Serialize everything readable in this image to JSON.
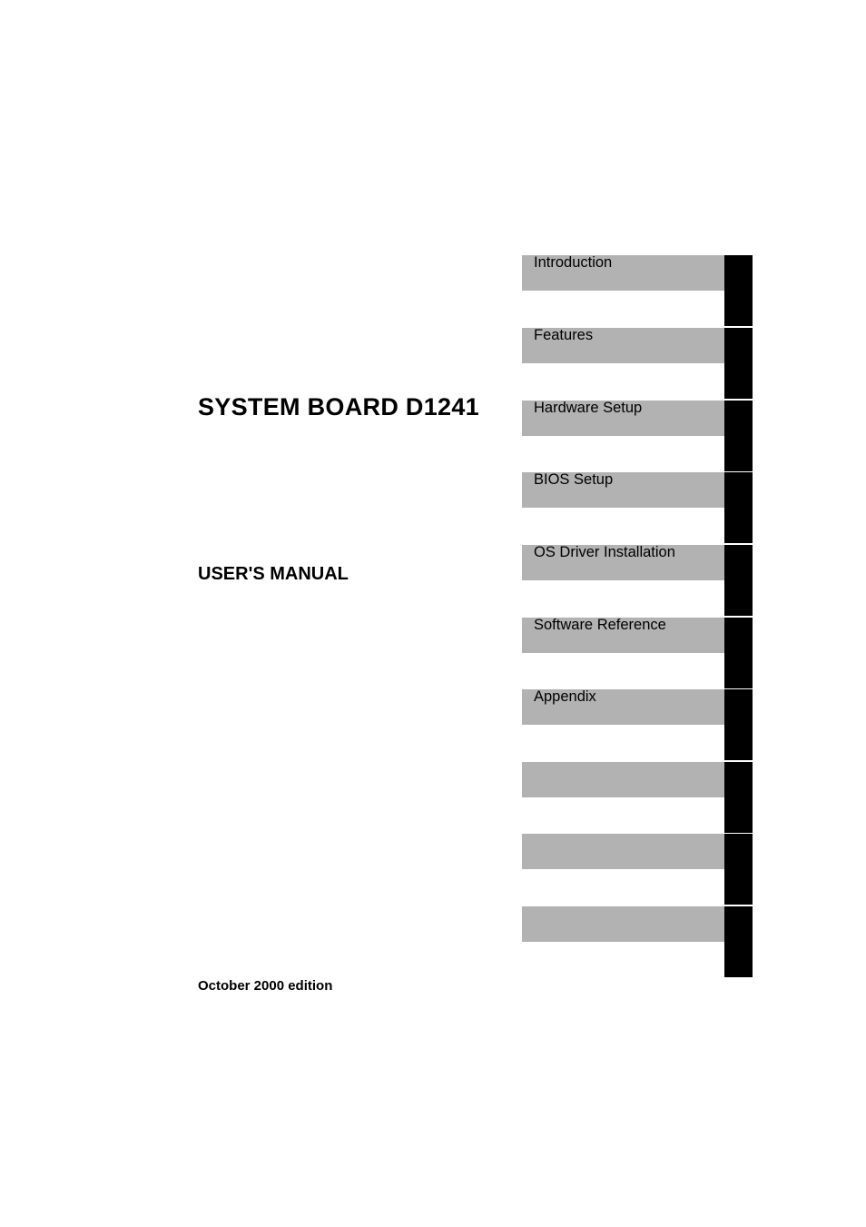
{
  "document": {
    "title": "SYSTEM BOARD D1241",
    "subtitle": "USER'S MANUAL",
    "edition": "October 2000 edition"
  },
  "tabs": [
    {
      "label": "Introduction"
    },
    {
      "label": "Features"
    },
    {
      "label": "Hardware Setup"
    },
    {
      "label": "BIOS Setup"
    },
    {
      "label": "OS Driver Installation"
    },
    {
      "label": "Software Reference"
    },
    {
      "label": "Appendix"
    },
    {
      "label": ""
    },
    {
      "label": ""
    },
    {
      "label": ""
    }
  ]
}
